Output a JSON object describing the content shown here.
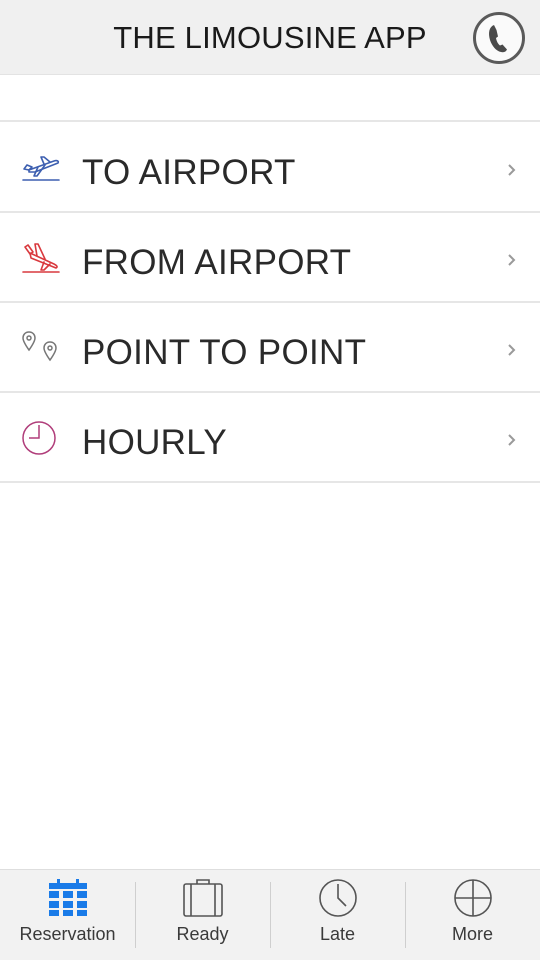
{
  "header": {
    "title": "THE LIMOUSINE APP",
    "phone_icon": "phone-icon"
  },
  "menu": {
    "items": [
      {
        "label": "TO AIRPORT",
        "icon": "plane-takeoff-icon",
        "icon_color": "#3d5fb0"
      },
      {
        "label": "FROM AIRPORT",
        "icon": "plane-landing-icon",
        "icon_color": "#d9393e"
      },
      {
        "label": "POINT TO POINT",
        "icon": "map-pin-icon",
        "icon_color": "#777777"
      },
      {
        "label": "HOURLY",
        "icon": "clock-icon",
        "icon_color": "#b03d7a"
      }
    ],
    "chevron_icon": "chevron-right-icon"
  },
  "tabbar": {
    "active_color": "#1a7be8",
    "inactive_color": "#3a3a3a",
    "tabs": [
      {
        "label": "Reservation",
        "icon": "calendar-icon",
        "active": true
      },
      {
        "label": "Ready",
        "icon": "briefcase-icon",
        "active": false
      },
      {
        "label": "Late",
        "icon": "clock-icon",
        "active": false
      },
      {
        "label": "More",
        "icon": "plus-circle-icon",
        "active": false
      }
    ]
  }
}
